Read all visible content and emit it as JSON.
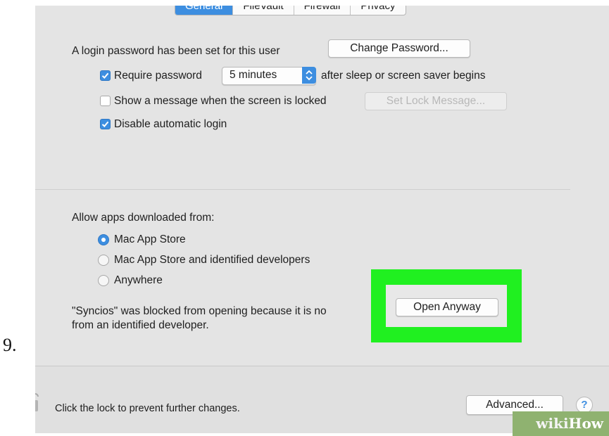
{
  "step_number": "9.",
  "tabs": [
    {
      "label": "General",
      "active": true
    },
    {
      "label": "FileVault",
      "active": false
    },
    {
      "label": "Firewall",
      "active": false
    },
    {
      "label": "Privacy",
      "active": false
    }
  ],
  "login": {
    "text": "A login password has been set for this user",
    "change_password_label": "Change Password..."
  },
  "require_password": {
    "checked": true,
    "label": "Require password",
    "delay_value": "5 minutes",
    "suffix": "after sleep or screen saver begins"
  },
  "lock_message": {
    "checked": false,
    "label": "Show a message when the screen is locked",
    "button_label": "Set Lock Message..."
  },
  "auto_login": {
    "checked": true,
    "label": "Disable automatic login"
  },
  "downloads": {
    "heading": "Allow apps downloaded from:",
    "options": [
      {
        "label": "Mac App Store",
        "selected": true
      },
      {
        "label": "Mac App Store and identified developers",
        "selected": false
      },
      {
        "label": "Anywhere",
        "selected": false
      }
    ]
  },
  "blocked": {
    "line1": "\"Syncios\" was blocked from opening because it is no",
    "line2": "from an identified developer.",
    "open_anyway_label": "Open Anyway"
  },
  "footer": {
    "lock_text": "Click the lock to prevent further changes.",
    "advanced_label": "Advanced...",
    "help_label": "?"
  },
  "watermark": {
    "wiki": "wiki",
    "how": "How"
  },
  "colors": {
    "accent": "#3d8ee0",
    "highlight": "#20f020",
    "window_bg": "#e4e4e4"
  }
}
